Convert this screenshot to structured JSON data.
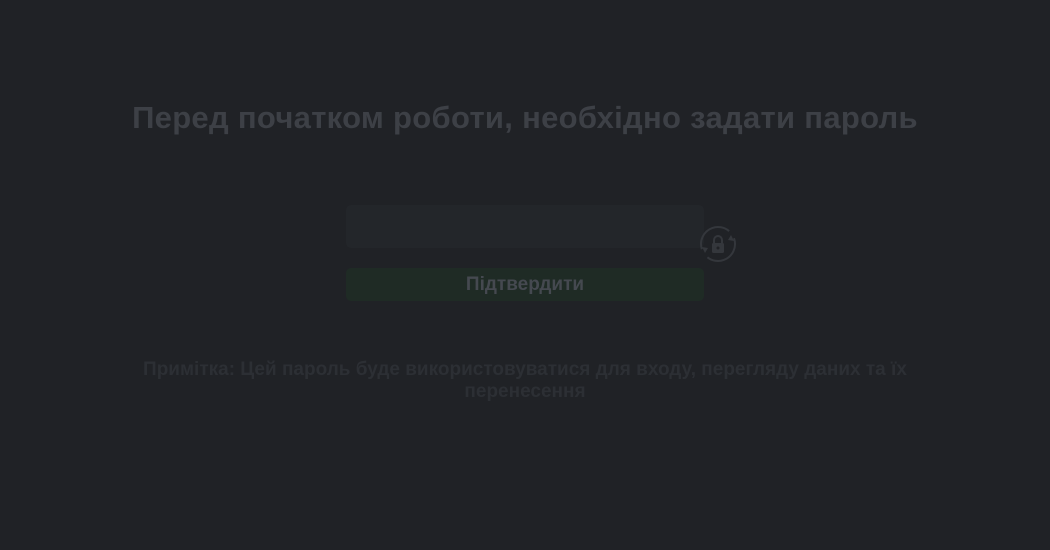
{
  "setup": {
    "title": "Перед початком роботи, необхідно задати пароль",
    "password": {
      "value": "",
      "placeholder": ""
    },
    "generate_icon": "refresh-lock-icon",
    "confirm_label": "Підтвердити",
    "note": "Примітка: Цей пароль буде використовуватися для входу, перегляду даних та їх перенесення"
  },
  "colors": {
    "background": "#202226",
    "title_text": "#3d4046",
    "input_bg": "#23262a",
    "confirm_bg": "#1f2b25",
    "note_text": "#2c2f34"
  }
}
